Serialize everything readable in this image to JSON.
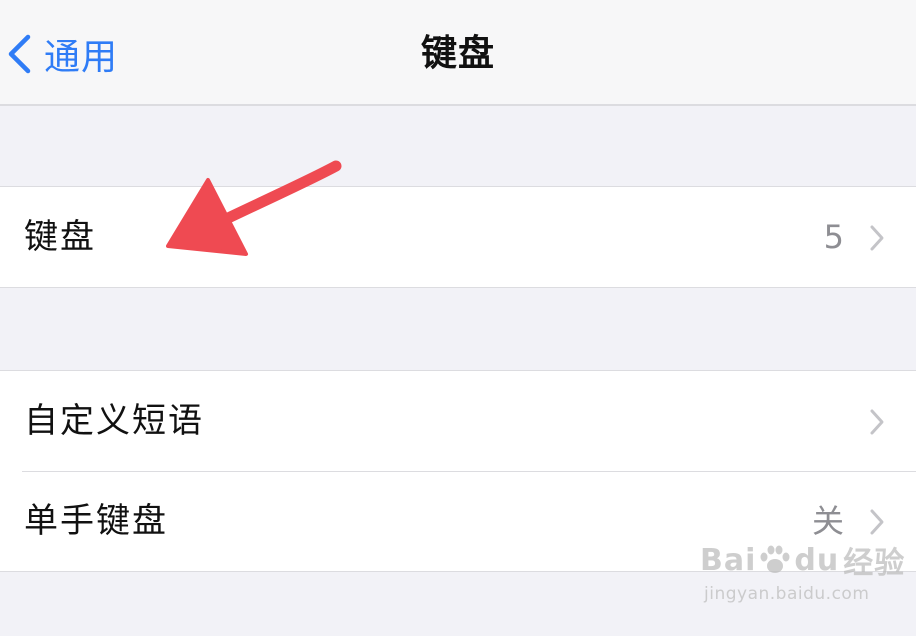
{
  "nav": {
    "back_label": "通用",
    "title": "键盘"
  },
  "groups": [
    {
      "cells": [
        {
          "label": "键盘",
          "value": "5"
        }
      ]
    },
    {
      "cells": [
        {
          "label": "自定义短语",
          "value": ""
        },
        {
          "label": "单手键盘",
          "value": "关"
        }
      ]
    }
  ],
  "colors": {
    "accent": "#2f7cf6",
    "annotation_arrow": "#ef4a52"
  },
  "watermark": {
    "brand_left": "Bai",
    "brand_right": "du",
    "brand_cn": "经验",
    "url": "jingyan.baidu.com"
  }
}
